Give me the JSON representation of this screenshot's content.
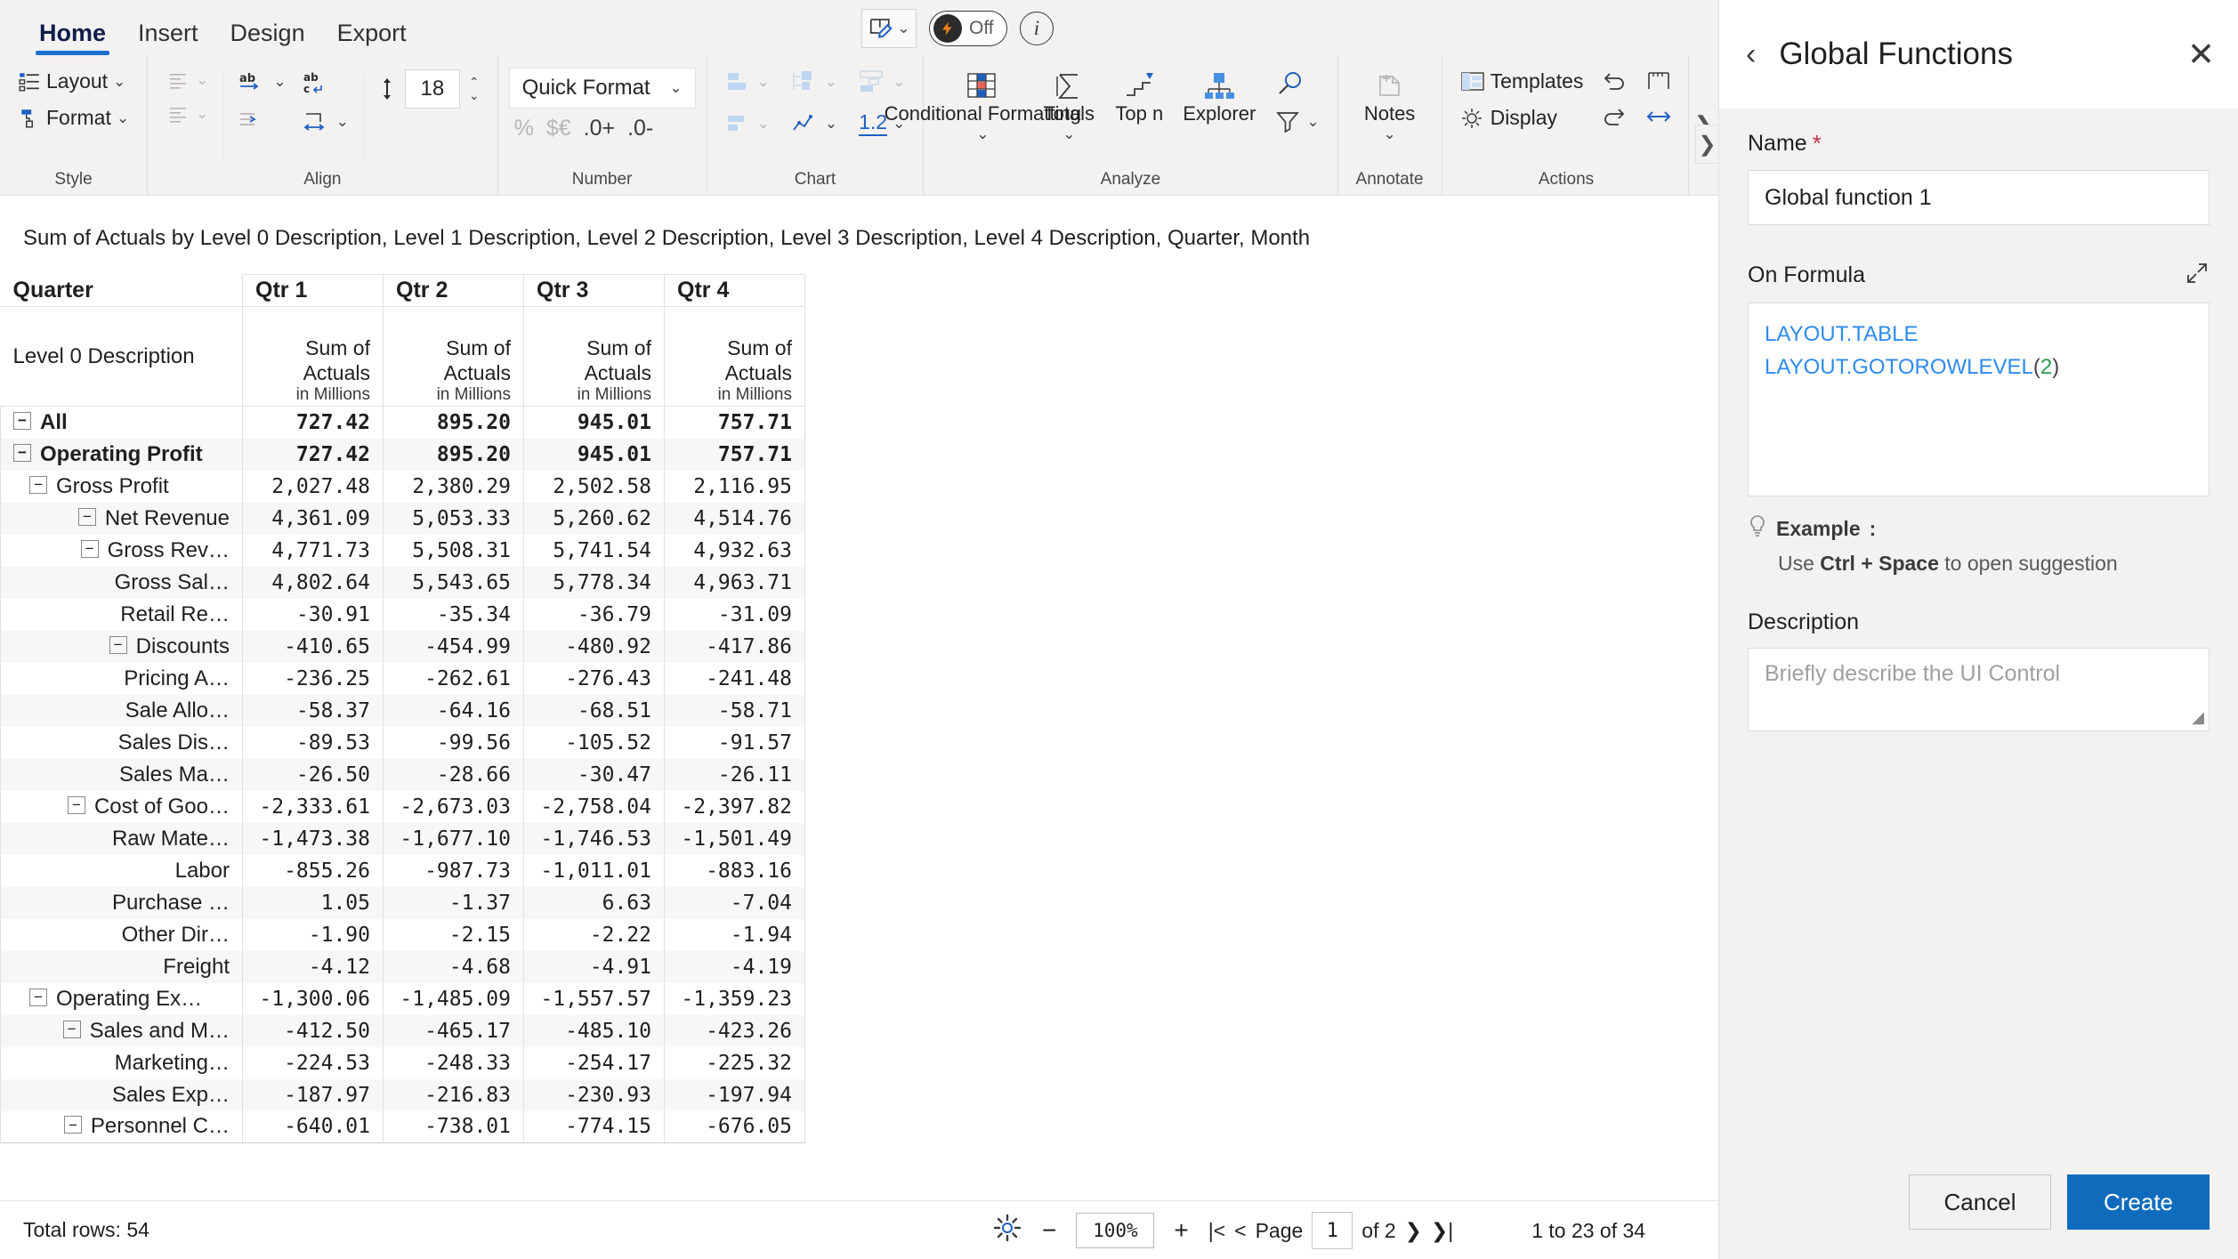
{
  "ribbon": {
    "tabs": [
      {
        "label": "Home",
        "active": true
      },
      {
        "label": "Insert",
        "active": false
      },
      {
        "label": "Design",
        "active": false
      },
      {
        "label": "Export",
        "active": false
      }
    ],
    "center": {
      "pen_icon": "pen-edit-icon",
      "toggle_label": "Off",
      "toggle_icon": "lightning-bolt-icon",
      "info_icon": "info-icon",
      "info_label": "i"
    },
    "groups": [
      {
        "name": "Style",
        "label": "Style",
        "buttons": [
          {
            "label": "Layout",
            "icon": "layout-icon",
            "chevron": true
          },
          {
            "label": "Format",
            "icon": "format-brush-icon",
            "chevron": true
          }
        ]
      },
      {
        "name": "Align",
        "label": "Align",
        "buttons": [
          {
            "label": "",
            "icon": "align-lines-icon",
            "chevron": true
          },
          {
            "label": "",
            "icon": "text-direction-icon",
            "chevron": true
          },
          {
            "label": "",
            "icon": "wrap-text-icon",
            "chevron": false
          },
          {
            "label": "",
            "icon": "align-indent-icon",
            "chevron": false
          },
          {
            "label": "",
            "icon": "indent-increase-icon",
            "chevron": false
          },
          {
            "label": "",
            "icon": "row-height-icon",
            "chevron": false
          }
        ],
        "line_height_value": "18"
      },
      {
        "name": "Number",
        "label": "Number",
        "quick_format": "Quick Format",
        "buttons": [
          {
            "label": "%",
            "icon": "percent-icon"
          },
          {
            "label": "$€",
            "icon": "currency-icon"
          },
          {
            "label": ".0+",
            "icon": "increase-decimal-icon"
          },
          {
            "label": ".0-",
            "icon": "decrease-decimal-icon"
          }
        ]
      },
      {
        "name": "Chart",
        "label": "Chart",
        "buttons": [
          {
            "label": "",
            "icon": "bar-chart-icon",
            "chevron": true
          },
          {
            "label": "",
            "icon": "tree-chart-icon",
            "chevron": true
          },
          {
            "label": "",
            "icon": "column-chart-icon",
            "chevron": true
          },
          {
            "label": "",
            "icon": "waterfall-chart-icon",
            "chevron": true
          },
          {
            "label": "",
            "icon": "sparkline-icon",
            "chevron": true
          },
          {
            "label": "1.2",
            "icon": "number-format-icon",
            "chevron": false
          }
        ]
      },
      {
        "name": "Analyze",
        "label": "Analyze",
        "buttons": [
          {
            "label": "Conditional Formatting",
            "icon": "conditional-formatting-icon",
            "chevron": true
          },
          {
            "label": "Totals",
            "icon": "sigma-icon",
            "chevron": true
          },
          {
            "label": "Top n",
            "icon": "top-n-icon",
            "chevron": false
          },
          {
            "label": "Explorer",
            "icon": "explorer-icon",
            "chevron": false
          },
          {
            "label": "",
            "icon": "search-icon",
            "chevron": false
          },
          {
            "label": "",
            "icon": "filter-icon",
            "chevron": true
          }
        ]
      },
      {
        "name": "Annotate",
        "label": "Annotate",
        "buttons": [
          {
            "label": "Notes",
            "icon": "add-note-icon",
            "chevron": true
          }
        ]
      },
      {
        "name": "Actions",
        "label": "Actions",
        "buttons": [
          {
            "label": "Templates",
            "icon": "templates-icon",
            "chevron": false
          },
          {
            "label": "Display",
            "icon": "gear-display-icon",
            "chevron": false
          },
          {
            "label": "",
            "icon": "undo-icon",
            "chevron": false
          },
          {
            "label": "",
            "icon": "redo-icon",
            "chevron": false
          },
          {
            "label": "",
            "icon": "measure-icon",
            "chevron": false
          },
          {
            "label": "",
            "icon": "resize-width-icon",
            "chevron": false
          }
        ]
      }
    ],
    "more_icon": "ribbon-overflow-chevron-icon"
  },
  "report": {
    "title": "Sum of Actuals by Level 0 Description, Level 1 Description, Level 2 Description, Level 3 Description, Level 4 Description, Quarter, Month"
  },
  "table": {
    "corner_label": "Quarter",
    "row_header_label": "Level 0 Description",
    "columns": [
      {
        "quarter": "Qtr 1",
        "measure": "Sum of Actuals",
        "unit": "in Millions"
      },
      {
        "quarter": "Qtr 2",
        "measure": "Sum of Actuals",
        "unit": "in Millions"
      },
      {
        "quarter": "Qtr 3",
        "measure": "Sum of Actuals",
        "unit": "in Millions"
      },
      {
        "quarter": "Qtr 4",
        "measure": "Sum of Actuals",
        "unit": "in Millions"
      }
    ],
    "rows": [
      {
        "label": "All",
        "indent": 0,
        "expander": true,
        "bold": true,
        "values": [
          "727.42",
          "895.20",
          "945.01",
          "757.71"
        ]
      },
      {
        "label": "Operating Profit",
        "indent": 0,
        "expander": true,
        "bold": true,
        "values": [
          "727.42",
          "895.20",
          "945.01",
          "757.71"
        ]
      },
      {
        "label": "Gross Profit",
        "indent": 1,
        "expander": true,
        "bold": false,
        "values": [
          "2,027.48",
          "2,380.29",
          "2,502.58",
          "2,116.95"
        ]
      },
      {
        "label": "Net Revenue",
        "indent": 2,
        "expander": true,
        "bold": false,
        "values": [
          "4,361.09",
          "5,053.33",
          "5,260.62",
          "4,514.76"
        ]
      },
      {
        "label": "Gross Rev…",
        "indent": 3,
        "expander": true,
        "bold": false,
        "values": [
          "4,771.73",
          "5,508.31",
          "5,741.54",
          "4,932.63"
        ]
      },
      {
        "label": "Gross Sal…",
        "indent": 4,
        "expander": false,
        "bold": false,
        "values": [
          "4,802.64",
          "5,543.65",
          "5,778.34",
          "4,963.71"
        ]
      },
      {
        "label": "Retail Re…",
        "indent": 4,
        "expander": false,
        "bold": false,
        "values": [
          "-30.91",
          "-35.34",
          "-36.79",
          "-31.09"
        ]
      },
      {
        "label": "Discounts",
        "indent": 3,
        "expander": true,
        "bold": false,
        "values": [
          "-410.65",
          "-454.99",
          "-480.92",
          "-417.86"
        ]
      },
      {
        "label": "Pricing A…",
        "indent": 4,
        "expander": false,
        "bold": false,
        "values": [
          "-236.25",
          "-262.61",
          "-276.43",
          "-241.48"
        ]
      },
      {
        "label": "Sale Allo…",
        "indent": 4,
        "expander": false,
        "bold": false,
        "values": [
          "-58.37",
          "-64.16",
          "-68.51",
          "-58.71"
        ]
      },
      {
        "label": "Sales Dis…",
        "indent": 4,
        "expander": false,
        "bold": false,
        "values": [
          "-89.53",
          "-99.56",
          "-105.52",
          "-91.57"
        ]
      },
      {
        "label": "Sales Ma…",
        "indent": 4,
        "expander": false,
        "bold": false,
        "values": [
          "-26.50",
          "-28.66",
          "-30.47",
          "-26.11"
        ]
      },
      {
        "label": "Cost of Goo…",
        "indent": 2,
        "expander": true,
        "bold": false,
        "values": [
          "-2,333.61",
          "-2,673.03",
          "-2,758.04",
          "-2,397.82"
        ]
      },
      {
        "label": "Raw Mate…",
        "indent": 3,
        "expander": false,
        "bold": false,
        "values": [
          "-1,473.38",
          "-1,677.10",
          "-1,746.53",
          "-1,501.49"
        ]
      },
      {
        "label": "Labor",
        "indent": 3,
        "expander": false,
        "bold": false,
        "values": [
          "-855.26",
          "-987.73",
          "-1,011.01",
          "-883.16"
        ]
      },
      {
        "label": "Purchase …",
        "indent": 3,
        "expander": false,
        "bold": false,
        "values": [
          "1.05",
          "-1.37",
          "6.63",
          "-7.04"
        ]
      },
      {
        "label": "Other Dir…",
        "indent": 3,
        "expander": false,
        "bold": false,
        "values": [
          "-1.90",
          "-2.15",
          "-2.22",
          "-1.94"
        ]
      },
      {
        "label": "Freight",
        "indent": 3,
        "expander": false,
        "bold": false,
        "values": [
          "-4.12",
          "-4.68",
          "-4.91",
          "-4.19"
        ]
      },
      {
        "label": "Operating Ex…",
        "indent": 1,
        "expander": true,
        "bold": false,
        "values": [
          "-1,300.06",
          "-1,485.09",
          "-1,557.57",
          "-1,359.23"
        ]
      },
      {
        "label": "Sales and M…",
        "indent": 2,
        "expander": true,
        "bold": false,
        "values": [
          "-412.50",
          "-465.17",
          "-485.10",
          "-423.26"
        ]
      },
      {
        "label": "Marketing…",
        "indent": 3,
        "expander": false,
        "bold": false,
        "values": [
          "-224.53",
          "-248.33",
          "-254.17",
          "-225.32"
        ]
      },
      {
        "label": "Sales Exp…",
        "indent": 3,
        "expander": false,
        "bold": false,
        "values": [
          "-187.97",
          "-216.83",
          "-230.93",
          "-197.94"
        ]
      },
      {
        "label": "Personnel C…",
        "indent": 2,
        "expander": true,
        "bold": false,
        "values": [
          "-640.01",
          "-738.01",
          "-774.15",
          "-676.05"
        ]
      }
    ]
  },
  "statusbar": {
    "total_rows": "Total rows: 54",
    "gear_icon": "settings-gear-icon",
    "zoom_minus": "−",
    "zoom_value": "100%",
    "zoom_plus": "+",
    "first_page_icon": "|<",
    "prev_page_icon": "<",
    "page_label": "Page",
    "page_value": "1",
    "page_of": "of 2",
    "next_page_icon": "❯",
    "last_page_icon": "❯|",
    "range_text": "1 to 23 of 34"
  },
  "panel": {
    "back_icon": "chevron-left-icon",
    "title": "Global Functions",
    "close_icon": "close-icon",
    "name_label": "Name",
    "name_required": "*",
    "name_value": "Global function 1",
    "formula_label": "On Formula",
    "expand_icon": "expand-diagonal-icon",
    "formula_lines": [
      {
        "text": "LAYOUT.TABLE",
        "arg": null
      },
      {
        "text": "LAYOUT.GOTOROWLEVEL",
        "arg": "2"
      }
    ],
    "example_icon": "lightbulb-icon",
    "example_label": "Example",
    "example_colon": ":",
    "example_prefix": "Use ",
    "example_keys": "Ctrl + Space",
    "example_suffix": " to open suggestion",
    "description_label": "Description",
    "description_placeholder": "Briefly describe the UI Control",
    "cancel_label": "Cancel",
    "create_label": "Create",
    "accent_color": "#0f6cbd",
    "required_color": "#c4314b"
  }
}
